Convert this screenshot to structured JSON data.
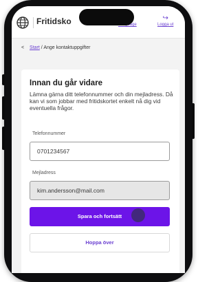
{
  "header": {
    "brand": "Fritidsko",
    "language_label": "Language",
    "logout_label": "Logga ut"
  },
  "breadcrumb": {
    "home": "Start",
    "separator": "/",
    "current": "Ange kontaktuppgifter"
  },
  "form": {
    "title": "Innan du går vidare",
    "description": "Lämna gärna ditt telefonnummer och din mejladress. Då kan vi som jobbar med fritidskortet enkelt nå dig vid eventuella frågor.",
    "phone_label": "Telefonnummer",
    "phone_value": "0701234567",
    "email_label": "Mejladress",
    "email_value": "kim.andersson@mail.com",
    "primary_button": "Spara och fortsätt",
    "secondary_button": "Hoppa över"
  },
  "colors": {
    "accent": "#6c14e8",
    "link": "#6a3fd1"
  }
}
